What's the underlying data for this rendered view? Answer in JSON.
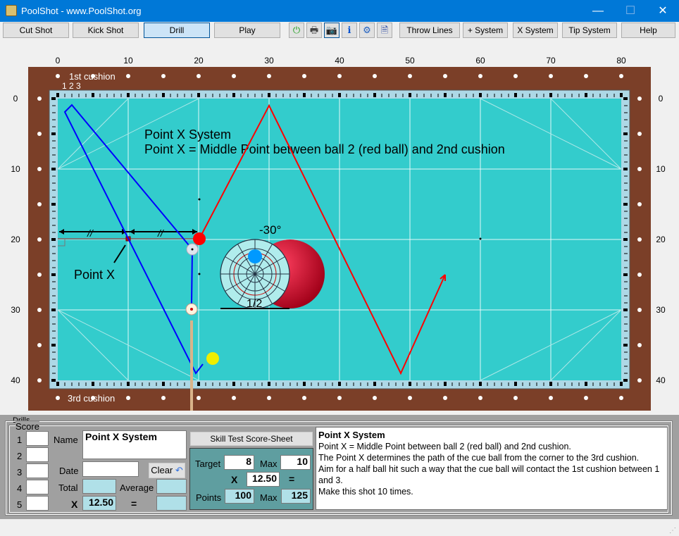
{
  "window": {
    "title": "PoolShot - www.PoolShot.org",
    "minimize": "—",
    "maximize": "☐",
    "close": "✕"
  },
  "toolbar": {
    "buttons": [
      {
        "label": "Cut Shot"
      },
      {
        "label": "Kick Shot"
      },
      {
        "label": "Drill",
        "active": true
      },
      {
        "label": "Play"
      }
    ],
    "icons": [
      {
        "name": "power-icon",
        "glyph": "⏻",
        "color": "#20a020"
      },
      {
        "name": "print-icon",
        "glyph": "🖶",
        "color": "#404040"
      },
      {
        "name": "camera-icon",
        "glyph": "📷",
        "color": "#000000"
      },
      {
        "name": "info-icon",
        "glyph": "ℹ",
        "color": "#0050d0"
      },
      {
        "name": "gear-icon",
        "glyph": "⚙",
        "color": "#2060c0"
      },
      {
        "name": "help-document-icon",
        "glyph": "🗎",
        "color": "#2040a0"
      }
    ],
    "right_buttons": [
      {
        "label": "Throw Lines"
      },
      {
        "label": "+ System"
      },
      {
        "label": "X System"
      },
      {
        "label": "Tip System"
      },
      {
        "label": "Help"
      }
    ]
  },
  "table": {
    "x_ticks": [
      "0",
      "10",
      "20",
      "30",
      "40",
      "50",
      "60",
      "70",
      "80"
    ],
    "y_ticks": [
      "0",
      "10",
      "20",
      "30",
      "40"
    ],
    "cushion1_label": "1st cushion",
    "cushion3_label": "3rd cushion",
    "diamond_numbers": "1 2 3",
    "title_line1": "Point X System",
    "title_line2": "Point X = Middle Point between ball 2 (red ball) and 2nd cushion",
    "point_x_label": "Point X",
    "angle_label": "-30°",
    "fraction_label": "1/2",
    "equal_marks": "//",
    "colors": {
      "cloth": "#33cccc",
      "rail": "#7b3f28",
      "cue_path": "#0000ff",
      "object_path": "#ff0000",
      "red_ball": "#ff0000",
      "yellow_ball": "#eeee00"
    }
  },
  "drills": {
    "group_label": "Drills",
    "score_label": "Score",
    "rows": [
      "1",
      "2",
      "3",
      "4",
      "5"
    ],
    "name_label": "Name",
    "name_value": "Point X System",
    "date_label": "Date",
    "date_value": "",
    "clear_label": "Clear",
    "total_label": "Total",
    "average_label": "Average",
    "x_label": "X",
    "multiplier": "12.50",
    "eq": "=",
    "scoresheet_label": "Skill Test Score-Sheet",
    "target_label": "Target",
    "target": "8",
    "max_label": "Max",
    "target_max": "10",
    "multiplier2": "12.50",
    "points_label": "Points",
    "points": "100",
    "points_max": "125"
  },
  "description": {
    "title": "Point X System",
    "lines": [
      "Point X = Middle Point between ball 2 (red ball) and 2nd cushion.",
      "The Point X determines the path of the cue ball from the corner to the 3rd cushion.",
      "Aim for a half ball hit such a way that the cue ball will contact the 1st cushion between 1 and 3.",
      "Make this shot 10 times."
    ]
  }
}
